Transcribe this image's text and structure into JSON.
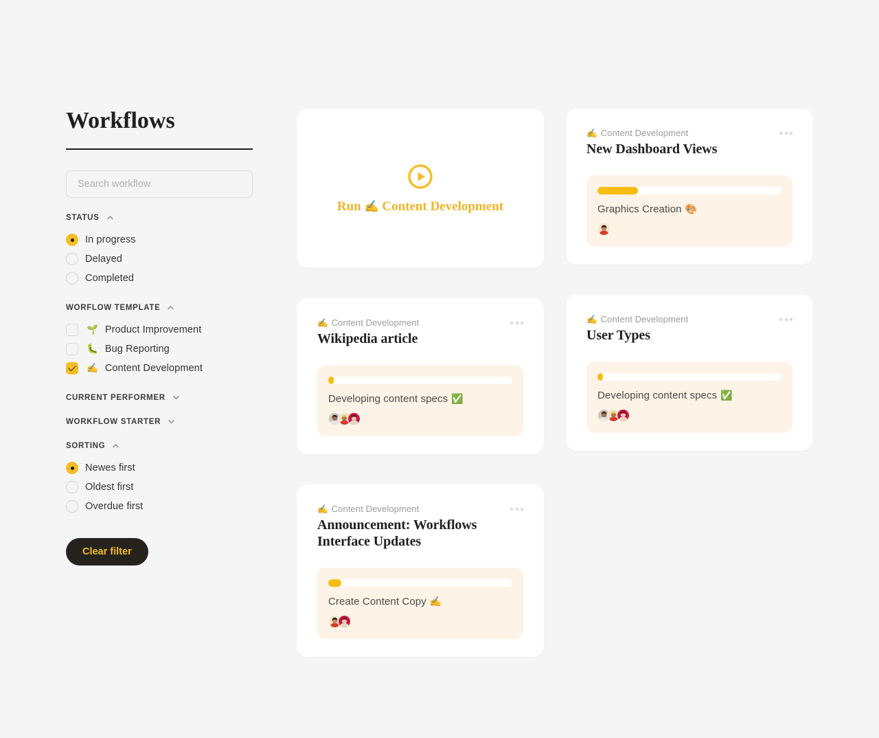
{
  "sidebar": {
    "title": "Workflows",
    "search": {
      "placeholder": "Search workflow",
      "value": ""
    },
    "groups": [
      {
        "label": "STATUS",
        "expanded": true,
        "chevron": "chevron-up-icon",
        "type": "radio",
        "options": [
          {
            "label": "In progress",
            "selected": true
          },
          {
            "label": "Delayed",
            "selected": false
          },
          {
            "label": "Completed",
            "selected": false
          }
        ]
      },
      {
        "label": "WORFLOW TEMPLATE",
        "expanded": true,
        "chevron": "chevron-up-icon",
        "type": "checkbox",
        "options": [
          {
            "label": "Product Improvement",
            "emoji": "🌱",
            "selected": false
          },
          {
            "label": "Bug Reporting",
            "emoji": "🐛",
            "selected": false
          },
          {
            "label": "Content Development",
            "emoji": "✍️",
            "selected": true
          }
        ]
      },
      {
        "label": "CURRENT PERFORMER",
        "expanded": false,
        "chevron": "chevron-down-icon",
        "type": "none",
        "options": []
      },
      {
        "label": "WORKFLOW STARTER",
        "expanded": false,
        "chevron": "chevron-down-icon",
        "type": "none",
        "options": []
      },
      {
        "label": "SORTING",
        "expanded": true,
        "chevron": "chevron-up-icon",
        "type": "radio",
        "options": [
          {
            "label": "Newes first",
            "selected": true
          },
          {
            "label": "Oldest first",
            "selected": false
          },
          {
            "label": "Overdue first",
            "selected": false
          }
        ]
      }
    ],
    "clear_filter_label": "Clear filter"
  },
  "run_card": {
    "icon": "play-circle-icon",
    "prefix": "Run",
    "emoji": "✍️",
    "template_name": "Content Development"
  },
  "cards": [
    {
      "column": "right",
      "template": "Content Development",
      "template_emoji": "✍️",
      "title": "New Dashboard Views",
      "menu": "more-options-icon",
      "task": {
        "name": "Graphics Creation",
        "emoji": "🎨",
        "progress_percent": 22
      },
      "assignees": [
        "avatar-red-shirt"
      ]
    },
    {
      "column": "left",
      "template": "Content Development",
      "template_emoji": "✍️",
      "title": "Wikipedia article",
      "menu": "more-options-icon",
      "task": {
        "name": "Developing content specs",
        "emoji": "✅",
        "progress_percent": 3
      },
      "assignees": [
        "avatar-grey",
        "avatar-hat",
        "avatar-crimson"
      ]
    },
    {
      "column": "right",
      "template": "Content Development",
      "template_emoji": "✍️",
      "title": "User Types",
      "menu": "more-options-icon",
      "task": {
        "name": "Developing content specs",
        "emoji": "✅",
        "progress_percent": 3
      },
      "assignees": [
        "avatar-grey",
        "avatar-hat",
        "avatar-crimson"
      ]
    },
    {
      "column": "left",
      "template": "Content Development",
      "template_emoji": "✍️",
      "title": "Announcement: Workflows Interface Updates",
      "menu": "more-options-icon",
      "task": {
        "name": "Create Content Copy",
        "emoji": "✍️",
        "progress_percent": 7
      },
      "assignees": [
        "avatar-red-shirt",
        "avatar-crimson"
      ]
    }
  ],
  "colors": {
    "accent": "#f5bd27",
    "accent_strong": "#f7bd11",
    "page_bg": "#f5f5f5",
    "card_bg": "#ffffff",
    "task_panel_bg": "#fdf3e7",
    "dark": "#26231f"
  }
}
